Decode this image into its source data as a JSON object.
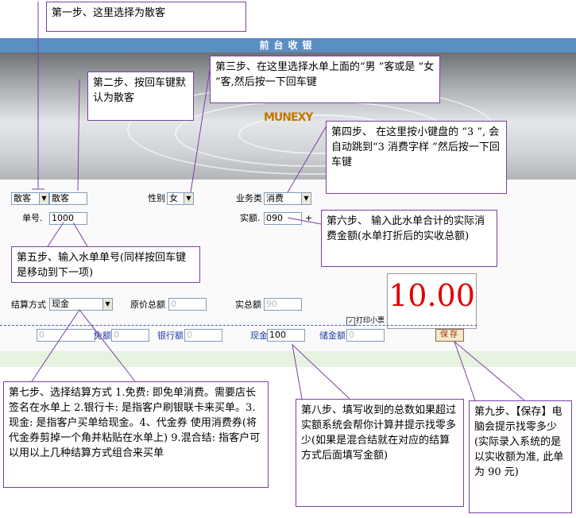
{
  "header": {
    "title": "前台收银"
  },
  "logo": "MUNEXY",
  "form": {
    "customer_type_select": "散客",
    "customer_name": "散客",
    "gender_label": "性别",
    "gender_value": "女",
    "business_label": "业务类",
    "business_value": "消费",
    "order_label": "单号.",
    "order_value": "1000",
    "actual_label": "实额.",
    "actual_value": "090",
    "actual_plus": "+",
    "settle_label": "结算方式",
    "settle_value": "现金",
    "orig_total_label": "原价总额",
    "orig_total_value": "0",
    "real_total_label": "实总额",
    "real_total_value": "90",
    "print_label": "打印小票",
    "amount_display": "10.00",
    "pay_first_value": "0",
    "free_label": "免额",
    "free_value": "0",
    "bank_label": "银行额",
    "bank_value": "0",
    "cash_label": "现金",
    "cash_value": "100",
    "stored_label": "储金额",
    "stored_value": "0",
    "save_label": "保存"
  },
  "callouts": {
    "step1": "第一步、这里选择为散客",
    "step2": "第二步、按回车键默认为散客",
    "step3": "第三步、在这里选择水单上面的“男 ”客或是 “女 ”客,然后按一下回车键",
    "step4": "第四步、 在这里按小键盘的 “3 ”, 会自动跳到“3 消费字样 ”然后按一下回车键",
    "step5": "第五步、输入水单单号(同样按回车键是移动到下一项)",
    "step6": "第六步、 输入此水单合计的实际消费金额(水单打折后的实收总额)",
    "step7": "第七步、选择结算方式 1.免费: 即免单消费。需要店长签名在水单上 2.银行卡: 是指客户刷银联卡来买单。3.现金: 是指客户买单给现金。4、代金券 使用消费券(将代金券剪掉一个角并粘贴在水单上) 9.混合结: 指客户可以用以上几种结算方式组合来买单",
    "step8": "第八步、填写收到的总数如果超过实额系统会帮你计算并提示找零多少(如果是混合结就在对应的结算方式后面填写金额)",
    "step9": "第九步、【保存】电脑会提示找零多少(实际录入系统的是以实收额为准, 此单为 90 元)"
  }
}
